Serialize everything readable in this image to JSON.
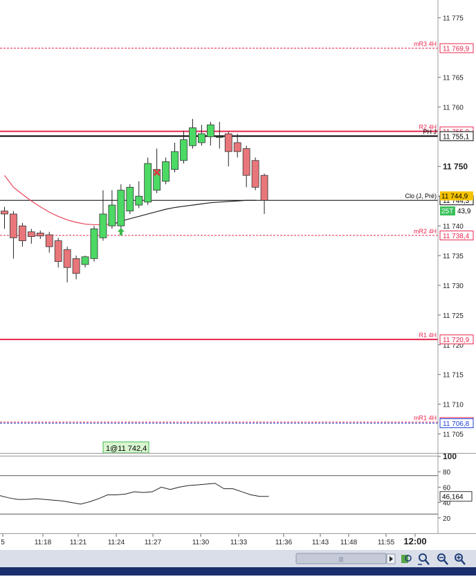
{
  "chart_data": [
    {
      "type": "candlestick",
      "title": "",
      "ylim": [
        11701.8,
        11778.0
      ],
      "y_ticks": [
        {
          "value": 11705,
          "label": "11 705",
          "bold": false
        },
        {
          "value": 11710,
          "label": "11 710",
          "bold": false
        },
        {
          "value": 11715,
          "label": "11 715",
          "bold": false
        },
        {
          "value": 11720,
          "label": "11 720",
          "bold": false
        },
        {
          "value": 11725,
          "label": "11 725",
          "bold": false
        },
        {
          "value": 11730,
          "label": "11 730",
          "bold": false
        },
        {
          "value": 11735,
          "label": "11 735",
          "bold": false
        },
        {
          "value": 11740,
          "label": "11 740",
          "bold": false
        },
        {
          "value": 11745,
          "label": "11 745",
          "bold": false
        },
        {
          "value": 11750,
          "label": "11 750",
          "bold": true
        },
        {
          "value": 11760,
          "label": "11 760",
          "bold": false
        },
        {
          "value": 11765,
          "label": "11 765",
          "bold": false
        },
        {
          "value": 11775,
          "label": "11 775",
          "bold": false
        }
      ],
      "candles": [
        {
          "time": "11:16",
          "open": 11742.5,
          "high": 11743.2,
          "low": 11739.5,
          "close": 11742.0
        },
        {
          "time": "11:17",
          "open": 11742.0,
          "high": 11742.5,
          "low": 11734.5,
          "close": 11738.0
        },
        {
          "time": "11:17",
          "open": 11740.0,
          "high": 11740.5,
          "low": 11736.5,
          "close": 11737.5
        },
        {
          "time": "11:18",
          "open": 11739.0,
          "high": 11739.5,
          "low": 11737.0,
          "close": 11738.2
        },
        {
          "time": "11:18",
          "open": 11738.8,
          "high": 11739.2,
          "low": 11737.8,
          "close": 11738.3
        },
        {
          "time": "11:19",
          "open": 11738.5,
          "high": 11739.0,
          "low": 11735.5,
          "close": 11736.5
        },
        {
          "time": "11:19",
          "open": 11737.5,
          "high": 11738.0,
          "low": 11733.0,
          "close": 11734.0
        },
        {
          "time": "11:20",
          "open": 11736.0,
          "high": 11736.5,
          "low": 11730.5,
          "close": 11733.0
        },
        {
          "time": "11:21",
          "open": 11734.5,
          "high": 11735.0,
          "low": 11731.0,
          "close": 11732.0
        },
        {
          "time": "11:21",
          "open": 11733.5,
          "high": 11735.0,
          "low": 11733.0,
          "close": 11734.8
        },
        {
          "time": "11:22",
          "open": 11734.5,
          "high": 11740.0,
          "low": 11734.0,
          "close": 11739.5
        },
        {
          "time": "11:23",
          "open": 11738.0,
          "high": 11746.0,
          "low": 11737.5,
          "close": 11742.0
        },
        {
          "time": "11:23",
          "open": 11740.0,
          "high": 11746.0,
          "low": 11739.5,
          "close": 11743.5
        },
        {
          "time": "11:24",
          "open": 11740.0,
          "high": 11747.0,
          "low": 11739.5,
          "close": 11746.0
        },
        {
          "time": "11:25",
          "open": 11742.5,
          "high": 11747.0,
          "low": 11742.0,
          "close": 11746.5
        },
        {
          "time": "11:25",
          "open": 11743.5,
          "high": 11747.5,
          "low": 11743.0,
          "close": 11745.0
        },
        {
          "time": "11:26",
          "open": 11744.0,
          "high": 11751.5,
          "low": 11743.5,
          "close": 11750.5
        },
        {
          "time": "11:27",
          "open": 11746.0,
          "high": 11753.0,
          "low": 11745.5,
          "close": 11749.5
        },
        {
          "time": "11:27",
          "open": 11747.5,
          "high": 11751.5,
          "low": 11747.0,
          "close": 11750.8
        },
        {
          "time": "11:28",
          "open": 11749.5,
          "high": 11754.0,
          "low": 11749.0,
          "close": 11752.5
        },
        {
          "time": "11:29",
          "open": 11751.0,
          "high": 11756.0,
          "low": 11750.5,
          "close": 11754.5
        },
        {
          "time": "11:29",
          "open": 11753.5,
          "high": 11758.0,
          "low": 11753.0,
          "close": 11756.5
        },
        {
          "time": "11:30",
          "open": 11754.0,
          "high": 11757.0,
          "low": 11753.5,
          "close": 11755.5
        },
        {
          "time": "11:31",
          "open": 11755.0,
          "high": 11757.5,
          "low": 11753.5,
          "close": 11757.0
        },
        {
          "time": "11:32",
          "open": 11755.0,
          "high": 11757.5,
          "low": 11753.0,
          "close": 11755.0
        },
        {
          "time": "11:32",
          "open": 11755.5,
          "high": 11755.8,
          "low": 11750.0,
          "close": 11752.5
        },
        {
          "time": "11:33",
          "open": 11754.0,
          "high": 11755.5,
          "low": 11751.5,
          "close": 11752.5
        },
        {
          "time": "11:33",
          "open": 11753.0,
          "high": 11753.5,
          "low": 11746.5,
          "close": 11748.5
        },
        {
          "time": "11:34",
          "open": 11751.0,
          "high": 11751.5,
          "low": 11746.0,
          "close": 11746.5
        },
        {
          "time": "11:35",
          "open": 11748.5,
          "high": 11748.8,
          "low": 11742.0,
          "close": 11744.3
        }
      ],
      "moving_averages": [
        {
          "color": "#e8425a",
          "points": [
            [
              0,
              11748.5
            ],
            [
              1,
              11746.5
            ],
            [
              2,
              11745.3
            ],
            [
              3,
              11744.2
            ],
            [
              4,
              11743.2
            ],
            [
              5,
              11742.3
            ],
            [
              6,
              11741.6
            ],
            [
              7,
              11741.0
            ],
            [
              8,
              11740.6
            ],
            [
              9,
              11740.3
            ],
            [
              10,
              11740.2
            ],
            [
              11,
              11740.2
            ],
            [
              12,
              11740.3
            ]
          ]
        },
        {
          "color": "#222222",
          "points": [
            [
              12,
              11740.2
            ],
            [
              13,
              11740.8
            ],
            [
              14,
              11741.2
            ],
            [
              15,
              11741.6
            ],
            [
              16,
              11742.0
            ],
            [
              17,
              11742.4
            ],
            [
              18,
              11742.8
            ],
            [
              19,
              11743.1
            ],
            [
              20,
              11743.3
            ],
            [
              21,
              11743.5
            ],
            [
              22,
              11743.7
            ],
            [
              23,
              11743.9
            ],
            [
              24,
              11744.0
            ],
            [
              25,
              11744.1
            ],
            [
              26,
              11744.2
            ],
            [
              27,
              11744.3
            ],
            [
              28,
              11744.3
            ]
          ]
        }
      ],
      "levels": [
        {
          "label": "mR3 4H",
          "value": 11769.9,
          "tag": "11 769,9",
          "color": "#e8254c",
          "style": "dashed"
        },
        {
          "label": "R2 4H",
          "value": 11755.9,
          "tag": "11 755,9",
          "color": "#e8254c",
          "style": "solid"
        },
        {
          "label": "PH J",
          "value": 11755.1,
          "tag": "11 755,1",
          "color": "#000000",
          "style": "solid"
        },
        {
          "label": "Clo (J, Pré)",
          "value": 11744.3,
          "tag": "11 744,3",
          "color": "#000000",
          "style": "thin"
        },
        {
          "label": "mR2 4H",
          "value": 11738.4,
          "tag": "11 738,4",
          "color": "#e8254c",
          "style": "dashed"
        },
        {
          "label": "R1 4H",
          "value": 11720.9,
          "tag": "11 720,9",
          "color": "#e8254c",
          "style": "solid"
        },
        {
          "label": "mR1 4H",
          "value": 11707.0,
          "tag": "11 707,0",
          "color": "#e8254c",
          "style": "dashed"
        },
        {
          "label": "",
          "value": 11706.8,
          "tag": "11 706,8",
          "color": "#1a3fd8",
          "style": "dashed"
        }
      ],
      "price_tags": [
        {
          "text": "11 744,9",
          "value": 11745.1,
          "bg": "#f5c400",
          "fg": "#000000"
        },
        {
          "text": "25T",
          "value": 11743.5,
          "bg": "#3cc15a",
          "fg": "#ffffff"
        },
        {
          "text": "43,9",
          "value": 11743.5,
          "bg": "#ffffff",
          "fg": "#000000"
        }
      ],
      "markers": {
        "sell_cross_at_candle": 17,
        "sell_cross_value": 11749.0,
        "buy_arrow_at_candle": 13,
        "buy_arrow_value": 11739.0
      },
      "position_label": "1@11 742,4"
    },
    {
      "type": "line",
      "title": "",
      "ylim": [
        0,
        100
      ],
      "y_ticks": [
        {
          "value": 100,
          "label": "100"
        },
        {
          "value": 80,
          "label": "80"
        },
        {
          "value": 60,
          "label": "60"
        },
        {
          "value": 40,
          "label": "40"
        },
        {
          "value": 20,
          "label": "20"
        }
      ],
      "levels": [
        75,
        25
      ],
      "values": [
        49,
        46,
        44,
        44,
        45,
        44,
        43,
        42,
        40,
        38,
        41,
        45,
        50,
        50,
        51,
        54,
        53,
        54,
        60,
        57,
        60,
        62,
        63,
        64,
        65,
        58,
        58,
        54,
        50,
        48,
        48
      ],
      "last_value_label": "46,164"
    }
  ],
  "x_axis_labels": [
    "5",
    "11:18",
    "11:21",
    "11:24",
    "11:27",
    "11:30",
    "11:33",
    "11:36",
    "11:43",
    "11:48",
    "11:55",
    "12:00"
  ],
  "colors": {
    "bull": "#4cd964",
    "bear": "#e8767a",
    "background": "#ffffff",
    "window_bottom": "#1a2e6e"
  },
  "toolbar": {
    "icons": [
      "scroll-right-icon",
      "chart-settings-icon",
      "zoom-fit-icon",
      "zoom-out-icon",
      "zoom-in-icon"
    ]
  }
}
